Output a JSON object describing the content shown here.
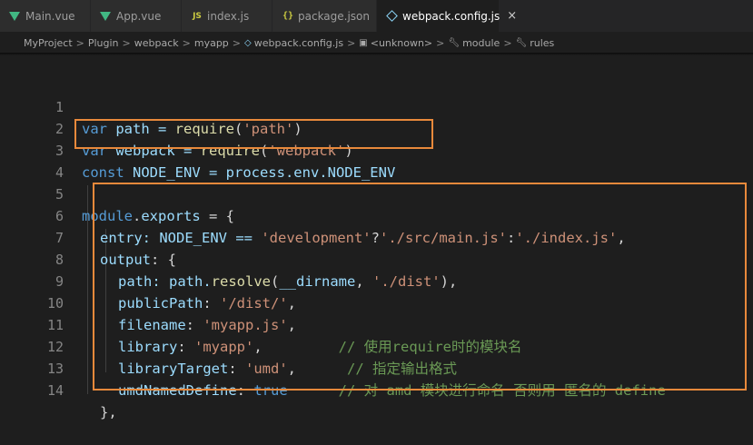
{
  "tabs": [
    {
      "label": "Main.vue",
      "icon": "vue-icon",
      "active": false
    },
    {
      "label": "App.vue",
      "icon": "vue-icon",
      "active": false
    },
    {
      "label": "index.js",
      "icon": "js-icon",
      "active": false
    },
    {
      "label": "package.json",
      "icon": "json-icon",
      "active": false
    },
    {
      "label": "webpack.config.js",
      "icon": "webpack-icon",
      "active": true
    }
  ],
  "tab_icons": {
    "js": "JS",
    "json": "{}",
    "close": "×"
  },
  "breadcrumb": {
    "items": [
      "MyProject",
      "Plugin",
      "webpack",
      "myapp",
      "webpack.config.js",
      "<unknown>",
      "module",
      "rules"
    ],
    "separator": ">"
  },
  "code": {
    "line_numbers": [
      "1",
      "2",
      "3",
      "4",
      "5",
      "6",
      "7",
      "8",
      "9",
      "10",
      "11",
      "12",
      "13",
      "14"
    ],
    "l1": {
      "kw": "var",
      "name": " path = ",
      "fn": "require",
      "p1": "(",
      "str": "'path'",
      "p2": ")"
    },
    "l2": {
      "kw": "var",
      "name": " webpack = ",
      "fn": "require",
      "p1": "(",
      "str": "'webpack'",
      "p2": ")"
    },
    "l3": {
      "kw": "const",
      "name": " NODE_ENV = process.env.NODE_ENV"
    },
    "l5": {
      "a": "module",
      "b": ".",
      "c": "exports",
      "d": " = {"
    },
    "l6": {
      "key": "entry",
      "a": ": NODE_ENV == ",
      "s1": "'development'",
      "q": "?",
      "s2": "'./src/main.js'",
      "c": ":",
      "s3": "'./index.js'",
      "e": ","
    },
    "l7": {
      "key": "output",
      "a": ": {"
    },
    "l8": {
      "key": "path",
      "a": ": path.",
      "fn": "resolve",
      "b": "(",
      "v": "__dirname",
      "c": ", ",
      "s": "'./dist'",
      "d": "),"
    },
    "l9": {
      "key": "publicPath",
      "a": ": ",
      "s": "'/dist/'",
      "b": ","
    },
    "l10": {
      "key": "filename",
      "a": ": ",
      "s": "'myapp.js'",
      "b": ","
    },
    "l11": {
      "key": "library",
      "a": ": ",
      "s": "'myapp'",
      "b": ",",
      "pad": "         ",
      "cmt": "// 使用require时的模块名"
    },
    "l12": {
      "key": "libraryTarget",
      "a": ": ",
      "s": "'umd'",
      "b": ",",
      "pad": "      ",
      "cmt": "// 指定输出格式"
    },
    "l13": {
      "key": "umdNamedDefine",
      "a": ": ",
      "kw": "true",
      "pad": "      ",
      "cmt": "// 对 amd 模块进行命名 否则用 匿名的 define"
    },
    "l14": {
      "a": "},"
    }
  },
  "colors": {
    "highlight": "#e8893b",
    "keyword": "#569cd6",
    "string": "#ce9178",
    "comment": "#6a9955",
    "function": "#dcdcaa"
  }
}
